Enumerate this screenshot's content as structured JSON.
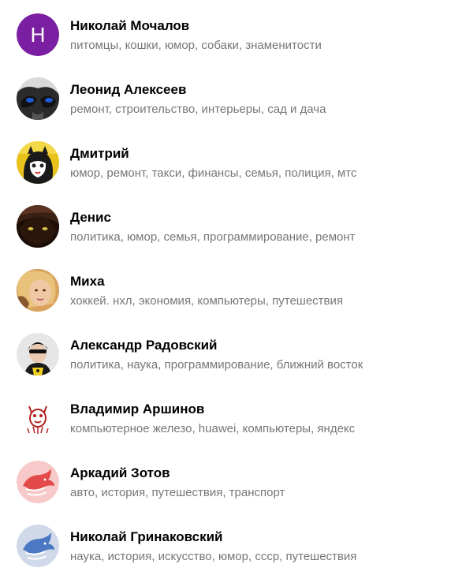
{
  "authors": [
    {
      "name": "Николай Мочалов",
      "topics": "питомцы, кошки, юмор, собаки, знаменитости",
      "avatar_letter": "Н",
      "avatar_color": "#7b1fa2"
    },
    {
      "name": "Леонид Алексеев",
      "topics": "ремонт, строительство, интерьеры, сад и дача"
    },
    {
      "name": "Дмитрий",
      "topics": "юмор, ремонт, такси, финансы, семья, полиция, мтс"
    },
    {
      "name": "Денис",
      "topics": "политика, юмор, семья, программирование, ремонт"
    },
    {
      "name": "Миха",
      "topics": "хоккей. нхл, экономия, компьютеры, путешествия"
    },
    {
      "name": "Александр Радовский",
      "topics": "политика, наука, программирование, ближний восток"
    },
    {
      "name": "Владимир Аршинов",
      "topics": "компьютерное железо, huawei, компьютеры, яндекс"
    },
    {
      "name": "Аркадий Зотов",
      "topics": "авто, история, путешествия, транспорт"
    },
    {
      "name": "Николай Гринаковский",
      "topics": "наука, история, искусство, юмор, ссср, путешествия"
    }
  ]
}
